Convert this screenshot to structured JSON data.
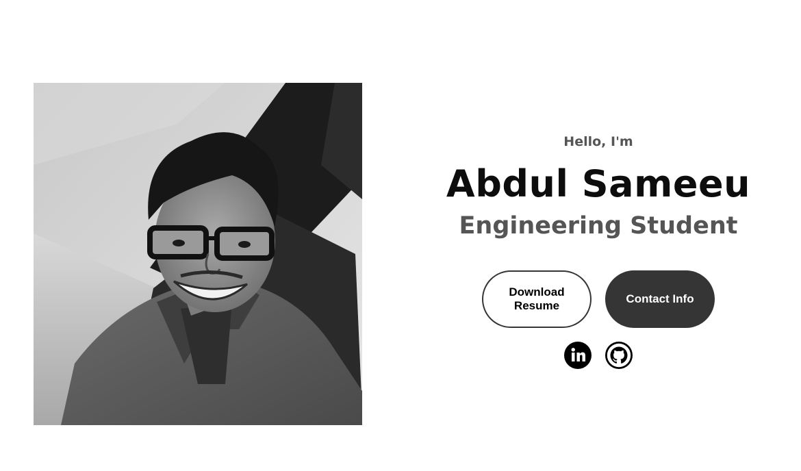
{
  "hero": {
    "greeting": "Hello, I'm",
    "name": "Abdul Sameeu",
    "role": "Engineering Student"
  },
  "buttons": {
    "download_resume": "Download Resume",
    "contact_info": "Contact Info"
  },
  "socials": [
    {
      "icon": "linkedin-icon"
    },
    {
      "icon": "github-icon"
    }
  ],
  "colors": {
    "text_dark": "#0d0d0d",
    "text_gray": "#555555",
    "button_dark": "#353535",
    "background": "#ffffff"
  },
  "photo": {
    "style": "grayscale"
  }
}
